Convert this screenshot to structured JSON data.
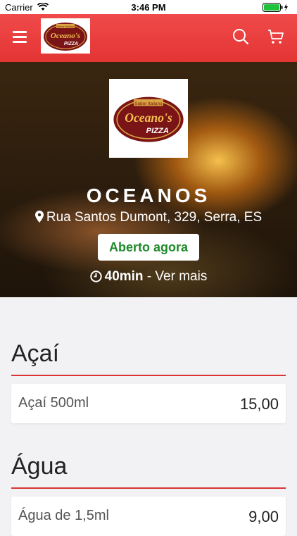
{
  "status_bar": {
    "carrier": "Carrier",
    "time": "3:46 PM"
  },
  "navbar": {
    "brand_color": "#e73b3b",
    "icons": [
      "menu-icon",
      "search-icon",
      "cart-icon"
    ]
  },
  "logo": {
    "text_top": "Sabor Italiano",
    "text_main": "Oceano's",
    "text_sub": "PIZZA"
  },
  "restaurant": {
    "name": "OCEANOS",
    "address": "Rua Santos Dumont, 329, Serra, ES",
    "status": "Aberto agora",
    "delivery_time": "40min",
    "more_link": " - Ver mais"
  },
  "menu": [
    {
      "category": "Açaí",
      "items": [
        {
          "name": "Açaí 500ml",
          "price": "15,00"
        }
      ]
    },
    {
      "category": "Água",
      "items": [
        {
          "name": "Água de 1,5ml",
          "price": "9,00"
        }
      ]
    }
  ]
}
